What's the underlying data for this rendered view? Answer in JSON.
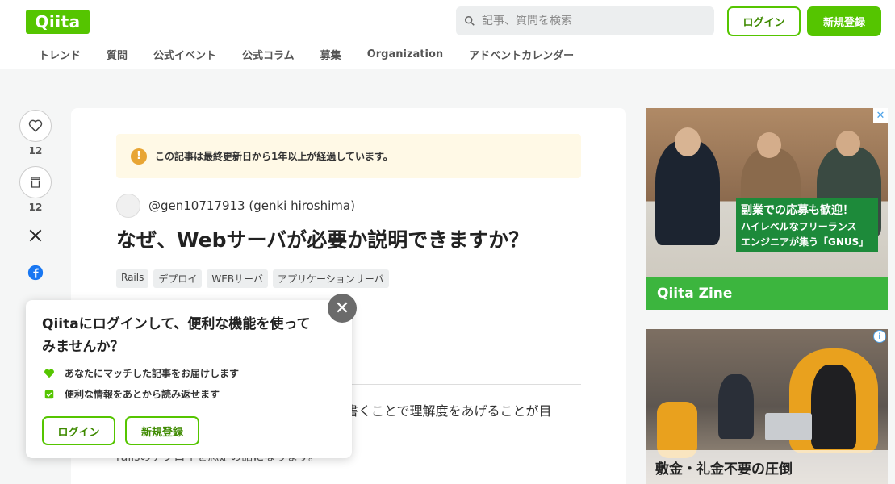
{
  "header": {
    "logo": "Qiita",
    "search_placeholder": "記事、質問を検索",
    "login_label": "ログイン",
    "signup_label": "新規登録",
    "nav": [
      "トレンド",
      "質問",
      "公式イベント",
      "公式コラム",
      "募集",
      "Organization",
      "アドベントカレンダー"
    ]
  },
  "actions": {
    "like_count": "12",
    "stock_count": "12"
  },
  "article": {
    "notice": "この記事は最終更新日から1年以上が経過しています。",
    "author": "@gen10717913 (genki hiroshima)",
    "title": "なぜ、Webサーバが必要か説明できますか？",
    "tags": [
      "Rails",
      "デプロイ",
      "WEBサーバ",
      "アプリケーションサーバ"
    ],
    "body_line1": "書くことで理解度をあげることが目",
    "body_line2": "railsのデプロイを想定の話になります。"
  },
  "ads": {
    "ad1_line1": "副業での応募も歓迎！",
    "ad1_line2": "ハイレベルなフリーランス",
    "ad1_line3": "エンジニアが集う「GNUS」",
    "ad1_brand": "Qiita Zine",
    "ad2_caption": "敷金・礼金不要の圧倒",
    "close_glyph": "✕",
    "info_glyph": "i"
  },
  "popup": {
    "title": "Qiitaにログインして、便利な機能を使ってみませんか？",
    "feature1": "あなたにマッチした記事をお届けします",
    "feature2": "便利な情報をあとから読み返せます",
    "login_label": "ログイン",
    "signup_label": "新規登録",
    "close_glyph": "✕"
  },
  "colors": {
    "brand": "#55c500",
    "notice_bg": "#fff9e6",
    "warning": "#e8a534"
  }
}
